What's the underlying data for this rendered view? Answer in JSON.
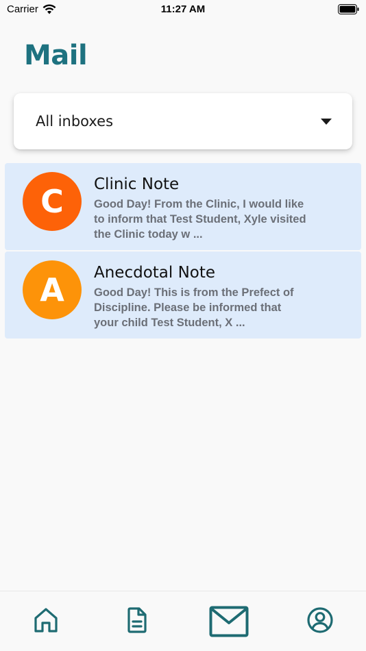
{
  "status_bar": {
    "carrier": "Carrier",
    "time": "11:27 AM"
  },
  "page": {
    "title": "Mail"
  },
  "inbox_select": {
    "selected": "All inboxes"
  },
  "mails": [
    {
      "avatar_letter": "C",
      "avatar_color": "#fd6208",
      "subject": "Clinic Note",
      "preview": "Good Day! From the Clinic, I would like to inform that Test Student, Xyle visited the Clinic today w ..."
    },
    {
      "avatar_letter": "A",
      "avatar_color": "#fd9309",
      "subject": "Anecdotal Note",
      "preview": "Good Day! This is from the Prefect of Discipline. Please be informed that your child Test Student, X ..."
    }
  ],
  "bottom_nav": {
    "items": [
      "home-icon",
      "document-icon",
      "mail-icon",
      "profile-icon"
    ],
    "active": "mail-icon",
    "icon_color": "#1e6b72"
  },
  "colors": {
    "accent": "#1e7280",
    "item_background": "#deebfb"
  }
}
